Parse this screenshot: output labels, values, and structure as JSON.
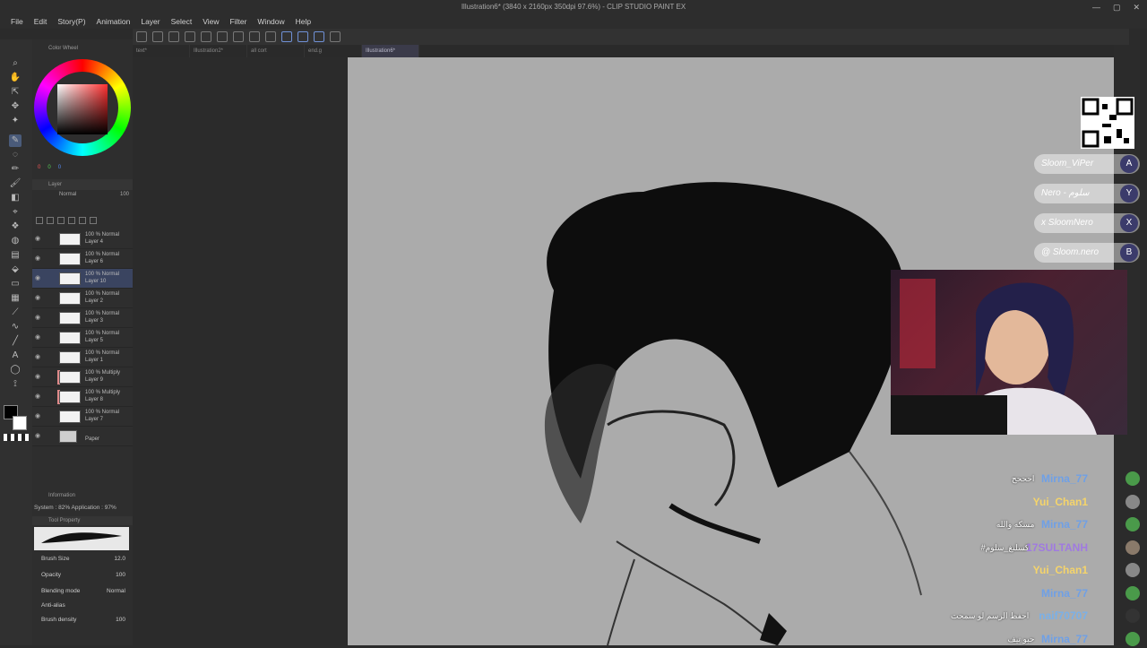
{
  "app": {
    "title": "Illustration6* (3840 x 2160px 350dpi 97.6%) - CLIP STUDIO PAINT EX"
  },
  "menu": [
    "File",
    "Edit",
    "Story(P)",
    "Animation",
    "Layer",
    "Select",
    "View",
    "Filter",
    "Window",
    "Help"
  ],
  "tabs": [
    {
      "label": "text*",
      "active": false
    },
    {
      "label": "Illustration2*",
      "active": false
    },
    {
      "label": "all cort",
      "active": false
    },
    {
      "label": "end.g",
      "active": false
    },
    {
      "label": "Illustration6*",
      "active": true
    }
  ],
  "color_panel": {
    "title": "Color Wheel",
    "rgb": [
      "0",
      "0",
      "0"
    ]
  },
  "layer_panel": {
    "title": "Layer",
    "blend_selected": "Normal",
    "opacity": "100",
    "layers": [
      {
        "blend": "100 % Normal",
        "name": "Layer 4",
        "selected": false,
        "mask": false
      },
      {
        "blend": "100 % Normal",
        "name": "Layer 6",
        "selected": false,
        "mask": false
      },
      {
        "blend": "100 % Normal",
        "name": "Layer 10",
        "selected": true,
        "mask": false
      },
      {
        "blend": "100 % Normal",
        "name": "Layer 2",
        "selected": false,
        "mask": false
      },
      {
        "blend": "100 % Normal",
        "name": "Layer 3",
        "selected": false,
        "mask": false
      },
      {
        "blend": "100 % Normal",
        "name": "Layer 5",
        "selected": false,
        "mask": false
      },
      {
        "blend": "100 % Normal",
        "name": "Layer 1",
        "selected": false,
        "mask": false
      },
      {
        "blend": "100 % Multiply",
        "name": "Layer 9",
        "selected": false,
        "mask": true
      },
      {
        "blend": "100 % Multiply",
        "name": "Layer 8",
        "selected": false,
        "mask": true
      },
      {
        "blend": "100 % Normal",
        "name": "Layer 7",
        "selected": false,
        "mask": false
      },
      {
        "blend": "",
        "name": "Paper",
        "selected": false,
        "mask": false
      }
    ]
  },
  "info_panel": {
    "title": "Information",
    "system": "System : 82% Application : 97%"
  },
  "tool_property": {
    "title": "Tool Property",
    "brush_size_label": "Brush Size",
    "brush_size": "12.0",
    "opacity_label": "Opacity",
    "opacity": "100",
    "blending_label": "Blending mode",
    "blending": "Normal",
    "antialias_label": "Anti-alias",
    "density_label": "Brush density",
    "density": "100"
  },
  "overlay": {
    "socials": [
      {
        "label": "Sloom_ViPer",
        "icon": "A",
        "icon_name": "kick-icon"
      },
      {
        "label": "Nero - سلوم",
        "icon": "Y",
        "icon_name": "youtube-icon"
      },
      {
        "label": "x SloomNero",
        "icon": "X",
        "icon_name": "x-icon"
      },
      {
        "label": "@ Sloom.nero",
        "icon": "B",
        "icon_name": "instagram-icon"
      }
    ],
    "chat": [
      {
        "user": "Mirna_77",
        "msg": "احححح",
        "color": "#6fa0e6",
        "av": "#4a9a4a"
      },
      {
        "user": "Yui_Chan1",
        "msg": "",
        "color": "#f5d46a",
        "av": "#888888"
      },
      {
        "user": "Mirna_77",
        "msg": "مسكه والله",
        "color": "#6fa0e6",
        "av": "#4a9a4a"
      },
      {
        "user": "17SULTANH",
        "msg": "#كسلنغ_سلوم",
        "color": "#a07ae0",
        "av": "#8a7a6a"
      },
      {
        "user": "Yui_Chan1",
        "msg": "",
        "color": "#f5d46a",
        "av": "#888888"
      },
      {
        "user": "Mirna_77",
        "msg": "",
        "color": "#6fa0e6",
        "av": "#4a9a4a"
      },
      {
        "user": "naif70707",
        "msg": "احفظ الرسم لو سمحت",
        "color": "#7ab0e8",
        "av": "#333333"
      },
      {
        "user": "Mirna_77",
        "msg": "حبو تيف",
        "color": "#6fa0e6",
        "av": "#4a9a4a"
      }
    ]
  }
}
